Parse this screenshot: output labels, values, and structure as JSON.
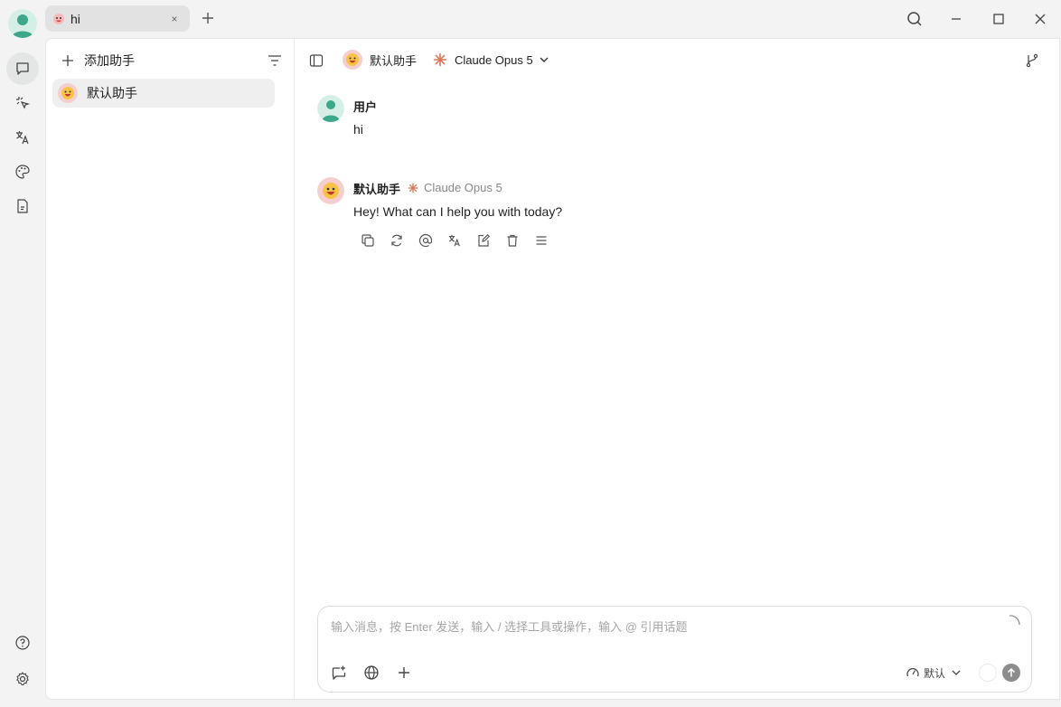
{
  "titlebar": {
    "tab_label": "hi",
    "tab_close": "×"
  },
  "sidebar": {
    "add_label": "添加助手",
    "assistants": [
      {
        "label": "默认助手"
      }
    ]
  },
  "chat_header": {
    "assistant": "默认助手",
    "model": "Claude Opus 5"
  },
  "messages": [
    {
      "name": "用户",
      "text": "hi"
    },
    {
      "name": "默认助手",
      "model": "Claude Opus 5",
      "text": "Hey! What can I help you with today?"
    }
  ],
  "composer": {
    "placeholder": "输入消息，按 Enter 发送，输入 / 选择工具或操作，输入 @ 引用话题",
    "think_label": "默认"
  },
  "colors": {
    "accent": "#3aa889",
    "claude": "#d97757"
  }
}
